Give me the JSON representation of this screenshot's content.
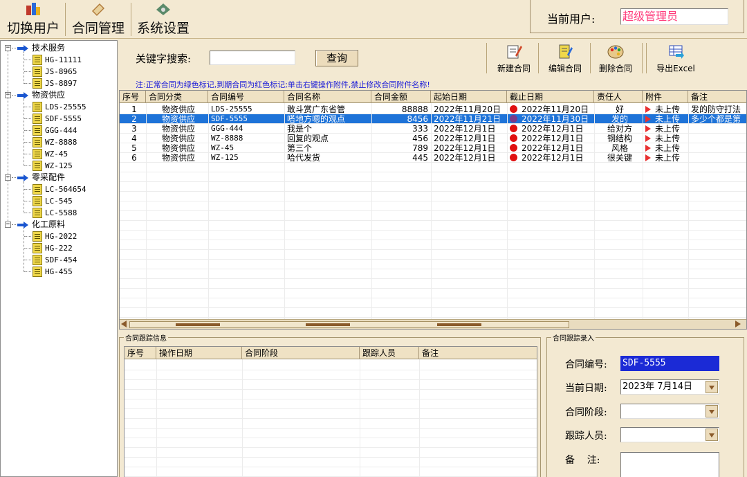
{
  "menubar": {
    "items": [
      {
        "label": "切换用户",
        "icon": "switch-user-icon"
      },
      {
        "label": "合同管理",
        "icon": "contract-manage-icon"
      },
      {
        "label": "系统设置",
        "icon": "system-settings-icon"
      }
    ],
    "current_user_label": "当前用户:",
    "current_user_value": "超级管理员"
  },
  "tree": {
    "categories": [
      {
        "label": "技术服务",
        "items": [
          "HG-11111",
          "JS-8965",
          "JS-8897"
        ]
      },
      {
        "label": "物资供应",
        "items": [
          "LDS-25555",
          "SDF-5555",
          "GGG-444",
          "WZ-8888",
          "WZ-45",
          "WZ-125"
        ]
      },
      {
        "label": "零采配件",
        "items": [
          "LC-564654",
          "LC-545",
          "LC-5588"
        ]
      },
      {
        "label": "化工原料",
        "items": [
          "HG-2022",
          "HG-222",
          "SDF-454",
          "HG-455"
        ]
      }
    ]
  },
  "search": {
    "label": "关键字搜索:",
    "value": "",
    "button": "查询"
  },
  "toolbar": {
    "new_contract": "新建合同",
    "edit_contract": "编辑合同",
    "delete_contract": "删除合同",
    "export_excel": "导出Excel"
  },
  "notice": "注:正常合同为绿色标记,到期合同为红色标记;单击右键操作附件,禁止修改合同附件名称!",
  "contracts_grid": {
    "headers": [
      "序号",
      "合同分类",
      "合同编号",
      "合同名称",
      "合同金额",
      "起始日期",
      "截止日期",
      "责任人",
      "附件",
      "备注"
    ],
    "rows": [
      {
        "no": "1",
        "category": "物资供应",
        "code": "LDS-25555",
        "name": "敢斗赏广东省管",
        "amount": "88888",
        "start": "2022年11月20日",
        "end": "2022年11月20日",
        "owner": "好",
        "attachment": "未上传",
        "remark": "发的防守打法"
      },
      {
        "no": "2",
        "category": "物资供应",
        "code": "SDF-5555",
        "name": "嗒地方嗯的观点",
        "amount": "8456",
        "start": "2022年11月21日",
        "end": "2022年11月30日",
        "owner": "发的",
        "attachment": "未上传",
        "remark": "多少个都是第"
      },
      {
        "no": "3",
        "category": "物资供应",
        "code": "GGG-444",
        "name": "我是个",
        "amount": "333",
        "start": "2022年12月1日",
        "end": "2022年12月1日",
        "owner": "给对方",
        "attachment": "未上传",
        "remark": ""
      },
      {
        "no": "4",
        "category": "物资供应",
        "code": "WZ-8888",
        "name": "回复的观点",
        "amount": "456",
        "start": "2022年12月1日",
        "end": "2022年12月1日",
        "owner": "钢结构",
        "attachment": "未上传",
        "remark": ""
      },
      {
        "no": "5",
        "category": "物资供应",
        "code": "WZ-45",
        "name": "第三个",
        "amount": "789",
        "start": "2022年12月1日",
        "end": "2022年12月1日",
        "owner": "风格",
        "attachment": "未上传",
        "remark": ""
      },
      {
        "no": "6",
        "category": "物资供应",
        "code": "WZ-125",
        "name": "哈代发货",
        "amount": "445",
        "start": "2022年12月1日",
        "end": "2022年12月1日",
        "owner": "很关键",
        "attachment": "未上传",
        "remark": ""
      }
    ],
    "selected_index": 1
  },
  "tracking_info": {
    "title": "合同跟踪信息",
    "headers": [
      "序号",
      "操作日期",
      "合同阶段",
      "跟踪人员",
      "备注"
    ]
  },
  "tracking_entry": {
    "title": "合同跟踪录入",
    "code_label": "合同编号:",
    "code_value": "SDF-5555",
    "date_label": "当前日期:",
    "date_value": "2023年 7月14日",
    "stage_label": "合同阶段:",
    "stage_value": "",
    "person_label": "跟踪人员:",
    "person_value": "",
    "remark_label": "备    注:"
  },
  "colors": {
    "background": "#f3e9d2",
    "selection": "#1e73d8",
    "notice_text": "#1a1ad8",
    "user_text": "#ff3a7a",
    "expired_marker": "#e01010"
  }
}
